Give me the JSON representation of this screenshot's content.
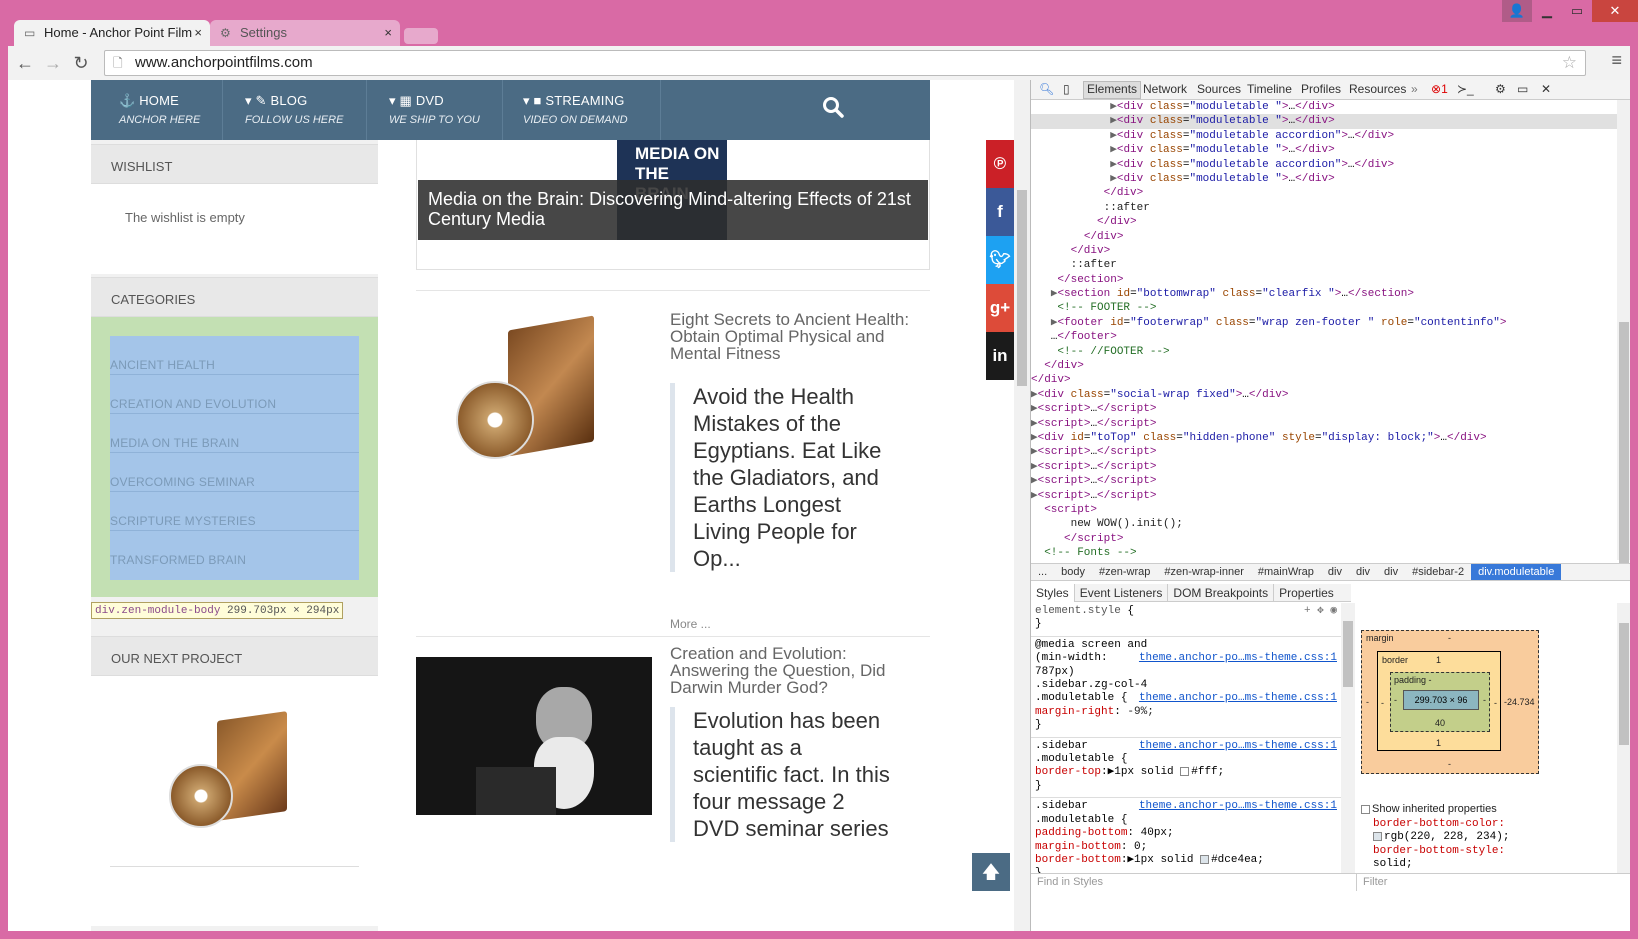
{
  "browser": {
    "tabs": [
      {
        "title": "Home - Anchor Point Film",
        "close": "×"
      },
      {
        "title": "Settings",
        "close": "×"
      }
    ],
    "url": "www.anchorpointfilms.com"
  },
  "site": {
    "nav": [
      {
        "title": "HOME",
        "sub": "ANCHOR HERE",
        "icon": "anchor-icon"
      },
      {
        "title": "BLOG",
        "sub": "FOLLOW US HERE",
        "icon": "edit-icon"
      },
      {
        "title": "DVD",
        "sub": "WE SHIP TO YOU",
        "icon": "film-icon"
      },
      {
        "title": "STREAMING",
        "sub": "VIDEO ON DEMAND",
        "icon": "video-camera-icon"
      }
    ],
    "sidebar": {
      "wishlist_title": "WISHLIST",
      "wishlist_empty": "The wishlist is empty",
      "categories_title": "CATEGORIES",
      "categories": [
        "ANCIENT HEALTH",
        "CREATION AND EVOLUTION",
        "MEDIA ON THE BRAIN",
        "OVERCOMING SEMINAR",
        "SCRIPTURE MYSTERIES",
        "TRANSFORMED BRAIN"
      ],
      "tooltip_selector": "div.zen-module-body",
      "tooltip_w": "299.703",
      "tooltip_h": "294",
      "tooltip_unit": "px",
      "tooltip_times": "×",
      "next_project_title": "OUR NEXT PROJECT"
    },
    "hero": {
      "caption": "Media on the Brain: Discovering Mind-altering Effects of 21st Century Media",
      "book_text": "MEDIA ON THE BRAIN"
    },
    "posts": [
      {
        "title": "Eight Secrets to Ancient Health: Obtain Optimal Physical and Mental Fitness",
        "excerpt": "Avoid the Health Mistakes of the Egyptians. Eat Like the Gladiators, and Earths Longest Living People for Op...",
        "more": "More ..."
      },
      {
        "title": "Creation and Evolution: Answering the Question, Did Darwin Murder God?",
        "excerpt": "Evolution has been taught as a scientific fact. In this four message 2 DVD seminar series"
      }
    ],
    "social": [
      "pinterest-icon",
      "facebook-icon",
      "twitter-icon",
      "google-plus-icon",
      "linkedin-icon"
    ],
    "social_colors": [
      "#cb2027",
      "#3b5998",
      "#1da1f2",
      "#dd4b39",
      "#1b1b1b"
    ]
  },
  "devtools": {
    "tabs": [
      "Elements",
      "Network",
      "Sources",
      "Timeline",
      "Profiles",
      "Resources"
    ],
    "more": "»",
    "errors": "1",
    "breadcrumbs": [
      "...",
      "body",
      "#zen-wrap",
      "#zen-wrap-inner",
      "#mainWrap",
      "div",
      "div",
      "div",
      "#sidebar-2",
      "div.moduletable"
    ],
    "subtabs": [
      "Styles",
      "Event Listeners",
      "DOM Breakpoints",
      "Properties"
    ],
    "find_placeholder": "Find in Styles",
    "filter_placeholder": "Filter",
    "show_inherited": "Show inherited properties",
    "boxmodel": {
      "margin_label": "margin",
      "margin_top": "-",
      "margin_bottom": "-",
      "margin_left": "-",
      "margin_right": "-24.734",
      "border_label": "border",
      "border_top": "1",
      "border_bottom": "1",
      "border_left": "-",
      "border_right": "-",
      "padding_label": "padding -",
      "padding_bottom": "40",
      "padding_left": "-",
      "padding_right": "-",
      "content": "299.703 × 96"
    },
    "inherited": [
      "border-bottom-color:",
      "rgb(220, 228, 234);",
      "border-bottom-style:",
      "solid;"
    ],
    "styles_src": "theme.anchor-po…ms-theme.css:1"
  }
}
